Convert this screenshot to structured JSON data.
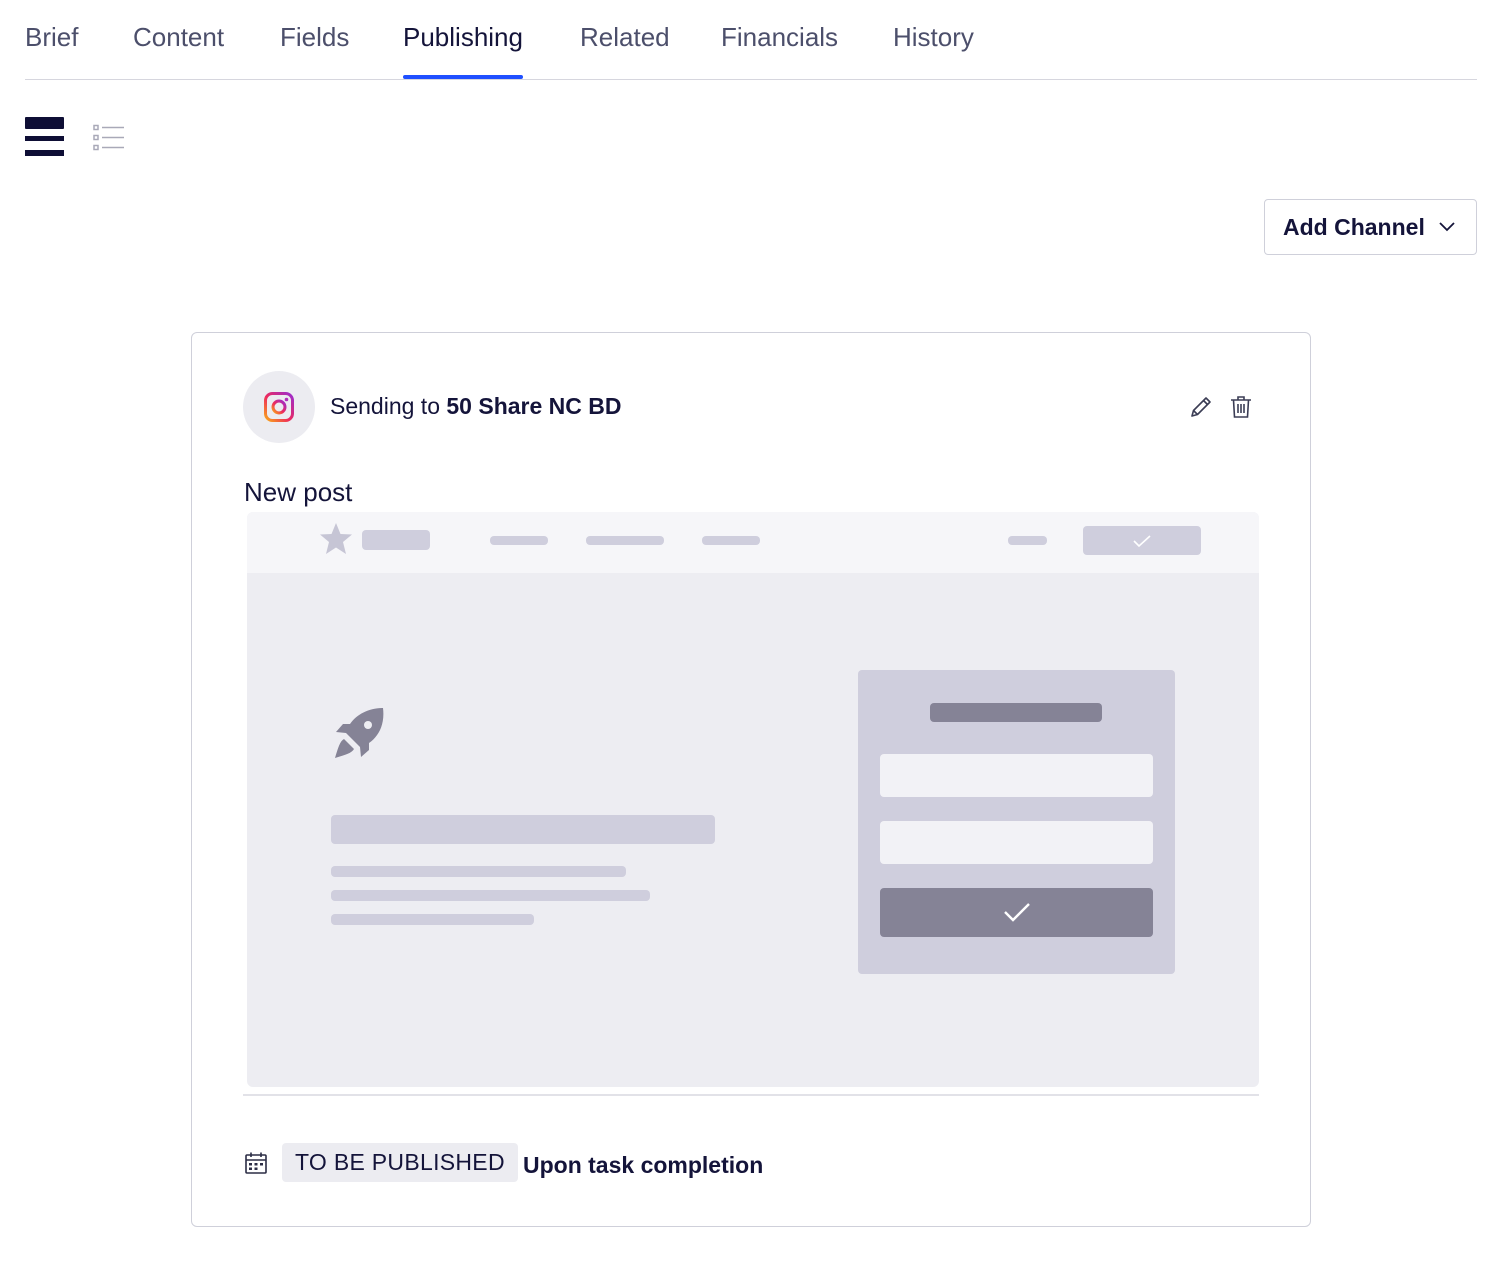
{
  "tabs": [
    {
      "label": "Brief",
      "active": false
    },
    {
      "label": "Content",
      "active": false
    },
    {
      "label": "Fields",
      "active": false
    },
    {
      "label": "Publishing",
      "active": true
    },
    {
      "label": "Related",
      "active": false
    },
    {
      "label": "Financials",
      "active": false
    },
    {
      "label": "History",
      "active": false
    }
  ],
  "view_toggle": {
    "selected": "card-view",
    "options": [
      "card-view",
      "list-view"
    ]
  },
  "add_channel": {
    "label": "Add Channel",
    "icon": "chevron-down-icon"
  },
  "channel_card": {
    "channel_icon": "instagram-icon",
    "sending_prefix": "Sending to ",
    "channel_name": "50 Share NC BD",
    "post_title": "New post",
    "actions": [
      "edit-icon",
      "trash-icon"
    ],
    "preview_icons": [
      "star-icon",
      "rocket-icon",
      "check-icon"
    ],
    "status_badge": "TO BE PUBLISHED",
    "schedule_text": "Upon task completion",
    "schedule_icon": "calendar-icon"
  },
  "colors": {
    "accent": "#1f4fff",
    "text_dark": "#14143a",
    "tab_inactive": "#4c4f6b",
    "badge_bg": "#ececf1",
    "preview_bg": "#ededf2",
    "placeholder": "#cfcedd",
    "placeholder_dark": "#858396"
  }
}
